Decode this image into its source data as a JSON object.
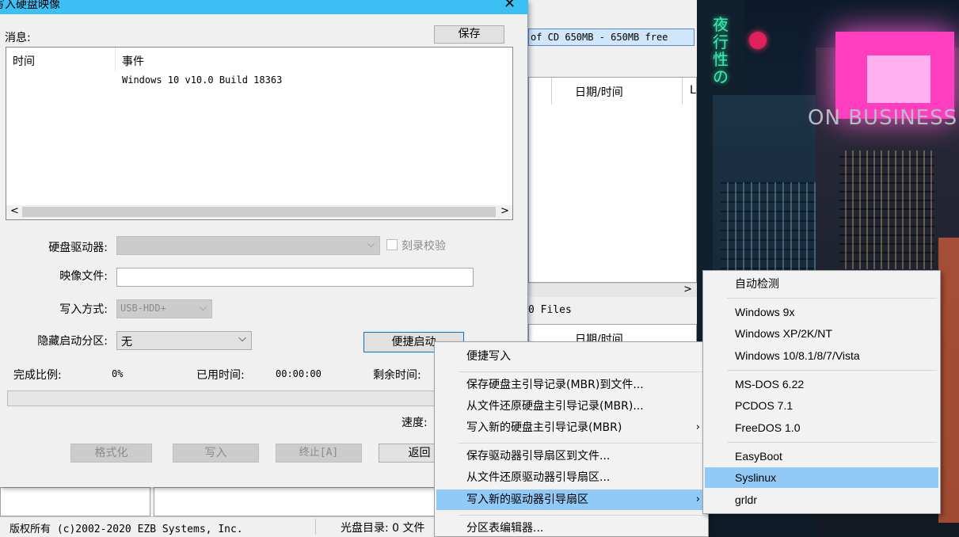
{
  "bg": {
    "cd_info": "of CD 650MB - 650MB free",
    "col_datetime_1": "日期/时间",
    "col_datetime_2": "日期/时间",
    "col_l": "L",
    "files_count": "0 Files",
    "statusbar": {
      "copyright": "版权所有 (c)2002-2020 EZB Systems, Inc.",
      "cd_dir": "光盘目录: 0 文件"
    }
  },
  "dialog": {
    "title": "写入硬盘映像",
    "messages_label": "消息:",
    "save_button": "保存",
    "log": {
      "col_time": "时间",
      "col_event": "事件",
      "rows": [
        {
          "time": "",
          "event": "Windows 10 v10.0 Build 18363"
        }
      ]
    },
    "disk_drive_label": "硬盘驱动器:",
    "verify_label": "刻录校验",
    "image_file_label": "映像文件:",
    "image_file_value": "",
    "write_method_label": "写入方式:",
    "write_method_value": "USB-HDD+",
    "hide_partition_label": "隐藏启动分区:",
    "hide_partition_value": "无",
    "quick_boot_button": "便捷启动",
    "progress": {
      "done_label": "完成比例:",
      "done_value": "0%",
      "elapsed_label": "已用时间:",
      "elapsed_value": "00:00:00",
      "remaining_label": "剩余时间:",
      "fraction": 0
    },
    "speed_label": "速度:",
    "buttons": {
      "format": "格式化",
      "write": "写入",
      "abort": "终止[A]",
      "back": "返回"
    }
  },
  "context_menu": {
    "items": [
      {
        "label": "便捷写入"
      },
      {
        "label": "保存硬盘主引导记录(MBR)到文件..."
      },
      {
        "label": "从文件还原硬盘主引导记录(MBR)..."
      },
      {
        "label": "写入新的硬盘主引导记录(MBR)",
        "submenu": true
      },
      {
        "label": "保存驱动器引导扇区到文件..."
      },
      {
        "label": "从文件还原驱动器引导扇区..."
      },
      {
        "label": "写入新的驱动器引导扇区",
        "submenu": true,
        "selected": true
      },
      {
        "label": "分区表编辑器..."
      }
    ]
  },
  "submenu": {
    "items": [
      {
        "label": "自动检测"
      },
      {
        "label": "Windows 9x"
      },
      {
        "label": "Windows XP/2K/NT"
      },
      {
        "label": "Windows 10/8.1/8/7/Vista"
      },
      {
        "label": "MS-DOS 6.22"
      },
      {
        "label": "PCDOS 7.1"
      },
      {
        "label": "FreeDOS 1.0"
      },
      {
        "label": "EasyBoot"
      },
      {
        "label": "Syslinux",
        "selected": true
      },
      {
        "label": "grldr"
      }
    ]
  },
  "wallpaper": {
    "sign_text": "夜行性の",
    "billboard_text": "ON BUSINESS"
  },
  "colors": {
    "title_bar": "#3cc0f4",
    "menu_highlight": "#91c9f7",
    "billboard": "#ff3fc0"
  }
}
